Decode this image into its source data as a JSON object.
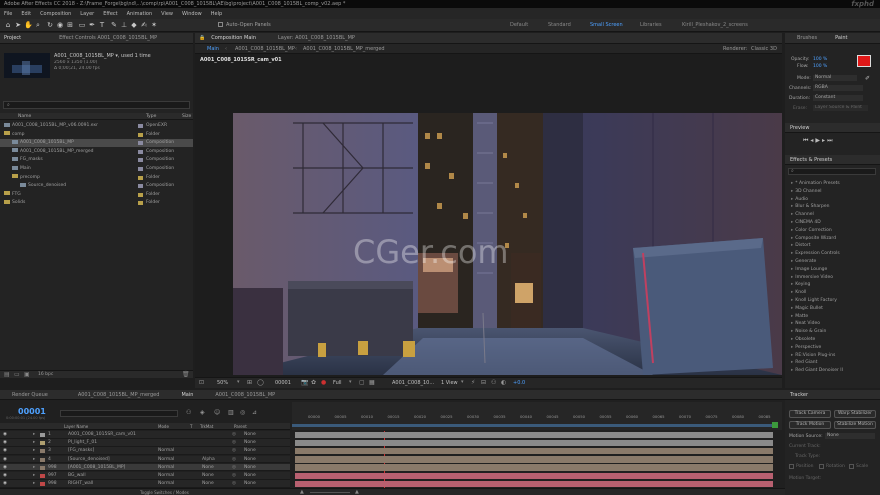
{
  "window": {
    "title": "Adobe After Effects CC 2018 - Z:\\Frame_Forge\\bg\\nd\\...\\comp\\rp\\A001_C008_1015BL\\AE\\bg\\project\\A001_C008_1015BL_comp_v02.aep *",
    "watermark_corner": "fxphd"
  },
  "menu": [
    "File",
    "Edit",
    "Composition",
    "Layer",
    "Effect",
    "Animation",
    "View",
    "Window",
    "Help"
  ],
  "toolbar": {
    "auto_open": "Auto-Open Panels",
    "workspaces": [
      "Default",
      "Standard",
      "Small Screen",
      "Libraries",
      "Kirill_Pleshakov_2_screens"
    ],
    "active_workspace": "Small Screen"
  },
  "project_panel": {
    "tabs": [
      "Project",
      "Effect Controls A001_C008_1015BL_MP"
    ],
    "selected": {
      "name": "A001_C008_1015BL_MP ▾, used 1 time",
      "dims": "2560 x 1350 (1.00)",
      "dur": "Δ 0;00;21, 24.00 fps"
    },
    "search_placeholder": "⌕",
    "cols": {
      "name": "Name",
      "type": "Type",
      "size": "Size"
    },
    "items": [
      {
        "indent": 0,
        "kind": "comp",
        "name": "A001_C008_1015BL_MP_v06.0091.exr",
        "type": "OpenEXR",
        "sel": false
      },
      {
        "indent": 0,
        "kind": "folder",
        "name": "comp",
        "type": "Folder",
        "sel": false
      },
      {
        "indent": 1,
        "kind": "comp",
        "name": "A001_C008_1015BL_MP",
        "type": "Composition",
        "sel": true
      },
      {
        "indent": 1,
        "kind": "comp",
        "name": "A001_C008_1015BL_MP_merged",
        "type": "Composition",
        "sel": false
      },
      {
        "indent": 1,
        "kind": "comp",
        "name": "FG_masks",
        "type": "Composition",
        "sel": false
      },
      {
        "indent": 1,
        "kind": "comp",
        "name": "Main",
        "type": "Composition",
        "sel": false
      },
      {
        "indent": 1,
        "kind": "folder",
        "name": "precomp",
        "type": "Folder",
        "sel": false
      },
      {
        "indent": 2,
        "kind": "comp",
        "name": "Source_denoised",
        "type": "Composition",
        "sel": false
      },
      {
        "indent": 0,
        "kind": "folder",
        "name": "FTG",
        "type": "Folder",
        "sel": false
      },
      {
        "indent": 0,
        "kind": "folder",
        "name": "Solids",
        "type": "Folder",
        "sel": false
      }
    ],
    "bpc": "16 bpc"
  },
  "comp_panel": {
    "tab": "Composition Main",
    "layer_tab": "Layer: A001_C008_1015BL_MP",
    "breadcrumbs": [
      "Main",
      "A001_C008_1015BL_MP",
      "A001_C008_1015BL_MP_merged"
    ],
    "renderer": "Renderer:",
    "renderer_value": "Classic 3D",
    "camera_label": "A001_C008_1015SR_cam_v01",
    "watermark": "CGer.com",
    "footer": {
      "zoom": "50%",
      "timecode": "00001",
      "res": "Full",
      "view": "A001_C008_10...",
      "views": "1 View",
      "exposure": "+0.0"
    }
  },
  "right_panel": {
    "tabs": [
      "Brushes",
      "Paint"
    ],
    "opacity_label": "Opacity:",
    "opacity": "100 %",
    "flow_label": "Flow:",
    "flow": "100 %",
    "mode_label": "Mode:",
    "mode": "Normal",
    "channels_label": "Channels:",
    "channels": "RGBA",
    "duration_label": "Duration:",
    "duration": "Constant",
    "erase_label": "Erase:",
    "erase": "Layer Source & Paint",
    "preview": "Preview",
    "effects_title": "Effects & Presets",
    "effects_search": "⌕",
    "effects": [
      "* Animation Presets",
      "3D Channel",
      "Audio",
      "Blur & Sharpen",
      "Channel",
      "CINEMA 4D",
      "Color Correction",
      "Composite Wizard",
      "Distort",
      "Expression Controls",
      "Generate",
      "Image Lounge",
      "Immersive Video",
      "Keying",
      "Knoll",
      "Knoll Light Factory",
      "Magic Bullet",
      "Matte",
      "Neat Video",
      "Noise & Grain",
      "Obsolete",
      "Perspective",
      "RE:Vision Plug-ins",
      "Red Giant",
      "Red Giant Denoiser II"
    ]
  },
  "timeline": {
    "tabs": [
      "Render Queue",
      "A001_C008_1015BL_MP_merged",
      "Main",
      "A001_C008_1015BL_MP"
    ],
    "timecode": "00001",
    "timecode_sub": "0:00:00:01 (24.00 fps)",
    "cols": [
      "Layer Name",
      "Mode",
      "T",
      "TrkMat",
      "Parent"
    ],
    "ruler": [
      "00000",
      "00005",
      "00010",
      "00015",
      "00020",
      "00025",
      "00030",
      "00035",
      "00040",
      "00045",
      "00050",
      "00055",
      "00060",
      "00065",
      "00070",
      "00075",
      "00080",
      "00085"
    ],
    "layers": [
      {
        "num": "1",
        "name": "A001_C008_1015SR_cam_v01",
        "mode": "",
        "trk": "",
        "parent": "None",
        "color": "#9c9c9c"
      },
      {
        "num": "2",
        "name": "PI_light_F_01",
        "mode": "",
        "trk": "",
        "parent": "None",
        "color": "#b0a070"
      },
      {
        "num": "3",
        "name": "[FG_masks]",
        "mode": "Normal",
        "trk": "",
        "parent": "None",
        "color": "#8a7a6a"
      },
      {
        "num": "4",
        "name": "[Source_denoised]",
        "mode": "Normal",
        "trk": "Alpha",
        "parent": "None",
        "color": "#8a7a6a"
      },
      {
        "num": "998",
        "name": "[A001_C008_1015BL_MP]",
        "mode": "Normal",
        "trk": "None",
        "parent": "None",
        "color": "#8a7a6a"
      },
      {
        "num": "997",
        "name": "BG_wall",
        "mode": "Normal",
        "trk": "None",
        "parent": "None",
        "color": "#c04848"
      },
      {
        "num": "998",
        "name": "RIGHT_wall",
        "mode": "Normal",
        "trk": "None",
        "parent": "None",
        "color": "#c04848"
      }
    ],
    "footer": "Toggle Switches / Modes"
  },
  "tracker": {
    "title": "Tracker",
    "buttons": [
      "Track Camera",
      "Warp Stabilizer",
      "Track Motion",
      "Stabilize Motion"
    ],
    "source_label": "Motion Source:",
    "source": "None",
    "current_track": "Current Track:",
    "track_type": "Track Type:",
    "checks": [
      "Position",
      "Rotation",
      "Scale"
    ],
    "motion_target": "Motion Target:"
  }
}
